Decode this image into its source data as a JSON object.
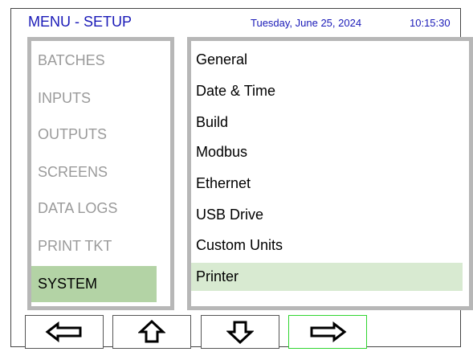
{
  "header": {
    "title": "MENU - SETUP",
    "date": "Tuesday, June 25, 2024",
    "time": "10:15:30"
  },
  "left_menu": {
    "items": [
      {
        "label": "BATCHES"
      },
      {
        "label": "INPUTS"
      },
      {
        "label": "OUTPUTS"
      },
      {
        "label": "SCREENS"
      },
      {
        "label": "DATA LOGS"
      },
      {
        "label": "PRINT TKT"
      },
      {
        "label": "SYSTEM",
        "selected": true
      }
    ]
  },
  "right_menu": {
    "items": [
      {
        "label": "General"
      },
      {
        "label": "Date & Time"
      },
      {
        "label": "Build"
      },
      {
        "label": "Modbus"
      },
      {
        "label": "Ethernet"
      },
      {
        "label": "USB Drive"
      },
      {
        "label": "Custom Units"
      },
      {
        "label": "Printer",
        "selected": true
      }
    ]
  },
  "nav_buttons": [
    {
      "name": "left-arrow",
      "icon": "arrow-left-icon"
    },
    {
      "name": "up-arrow",
      "icon": "arrow-up-icon"
    },
    {
      "name": "down-arrow",
      "icon": "arrow-down-icon"
    },
    {
      "name": "right-arrow",
      "icon": "arrow-right-icon",
      "selected": true
    }
  ],
  "colors": {
    "title_blue": "#1a1ab8",
    "left_selected": "#b3d3a5",
    "right_selected": "#d8ead1",
    "panel_border": "#b7b7b7",
    "inactive_text": "#9a9a9a",
    "active_button_border": "#31d531"
  }
}
